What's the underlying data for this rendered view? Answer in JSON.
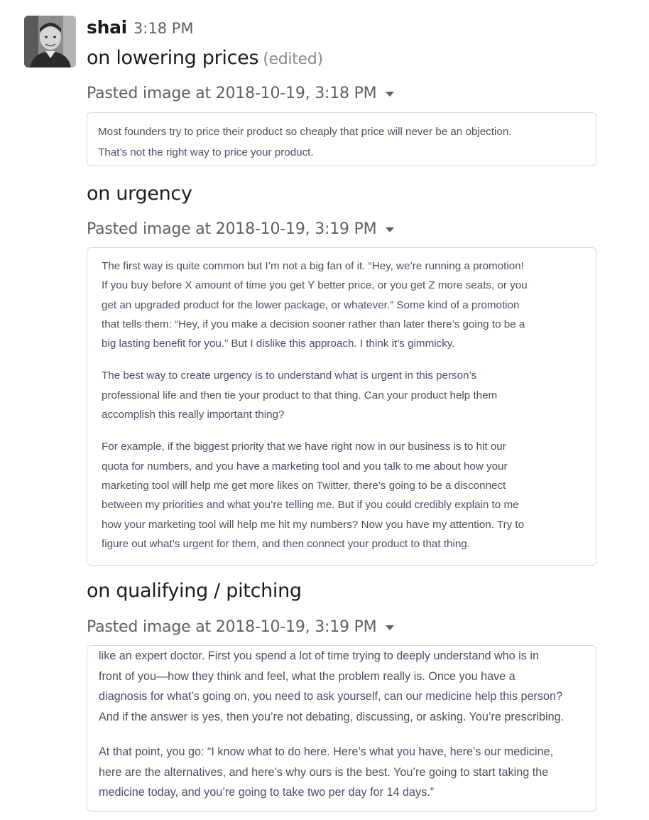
{
  "message": {
    "username": "shai",
    "time": "3:18 PM"
  },
  "sections": [
    {
      "title": "on lowering prices",
      "edited_label": "(edited)",
      "file_label": "Pasted image at 2018-10-19, 3:18 PM",
      "paragraphs": [
        "Most founders try to price their product so cheaply that price will never be an objection.\nThat’s not the right way to price your product."
      ]
    },
    {
      "title": "on urgency",
      "file_label": "Pasted image at 2018-10-19, 3:19 PM",
      "paragraphs": [
        "The first way is quite common but I’m not a big fan of it. “Hey, we’re running a promotion!\nIf you buy before X amount of time you get Y better price, or you get Z more seats, or you\nget an upgraded product for the lower package, or whatever.” Some kind of a promotion\nthat tells them: “Hey, if you make a decision sooner rather than later there’s going to be a\nbig lasting benefit for you.” But I dislike this approach. I think it’s gimmicky.",
        "The best way to create urgency is to understand what is urgent in this person’s\nprofessional life and then tie your product to that thing. Can your product help them\naccomplish this really important thing?",
        "For example, if the biggest priority that we have right now in our business is to hit our\nquota for numbers, and you have a marketing tool and you talk to me about how your\nmarketing tool will help me get more likes on Twitter, there’s going to be a disconnect\nbetween my priorities and what you’re telling me. But if you could credibly explain to me\nhow your marketing tool will help me hit my numbers? Now you have my attention. Try to\nfigure out what’s urgent for them, and then connect your product to that thing."
      ]
    },
    {
      "title": "on qualifying / pitching",
      "file_label": "Pasted image at 2018-10-19, 3:19 PM",
      "paragraphs": [
        "like an expert doctor. First you spend a lot of time trying to deeply understand who is in\nfront of you—how they think and feel, what the problem really is. Once you have a\ndiagnosis for what’s going on, you need to ask yourself, can our medicine help this person?\nAnd if the answer is yes, then you’re not debating, discussing, or asking. You’re prescribing.",
        "At that point, you go: “I know what to do here. Here’s what you have, here’s our medicine,\nhere are the alternatives, and here’s why ours is the best. You’re going to start taking the\nmedicine today, and you’re going to take two per day for 14 days.”"
      ]
    }
  ]
}
